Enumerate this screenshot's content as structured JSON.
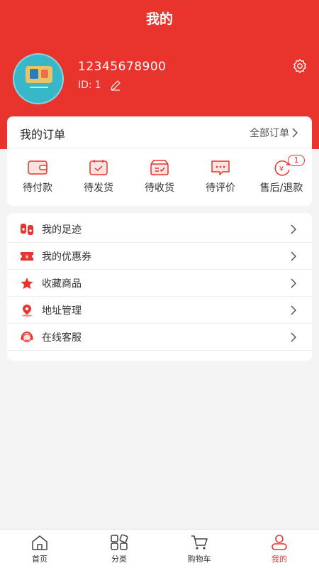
{
  "header": {
    "title": "我的"
  },
  "profile": {
    "phone": "12345678900",
    "id_label": "ID:",
    "id_value": "1"
  },
  "orders": {
    "title": "我的订单",
    "all_label": "全部订单",
    "items": [
      {
        "label": "待付款",
        "icon": "wallet-icon"
      },
      {
        "label": "待发货",
        "icon": "calendar-check-icon"
      },
      {
        "label": "待收货",
        "icon": "box-icon"
      },
      {
        "label": "待评价",
        "icon": "comment-icon"
      },
      {
        "label": "售后/退款",
        "icon": "refund-icon",
        "badge": "1"
      }
    ]
  },
  "menu": {
    "items": [
      {
        "label": "我的足迹",
        "icon": "footprint-icon"
      },
      {
        "label": "我的优惠券",
        "icon": "coupon-icon"
      },
      {
        "label": "收藏商品",
        "icon": "star-icon"
      },
      {
        "label": "地址管理",
        "icon": "location-pin-icon"
      },
      {
        "label": "在线客服",
        "icon": "customer-service-icon"
      }
    ]
  },
  "tabbar": {
    "items": [
      {
        "label": "首页",
        "icon": "home-icon"
      },
      {
        "label": "分类",
        "icon": "category-icon"
      },
      {
        "label": "购物车",
        "icon": "cart-icon"
      },
      {
        "label": "我的",
        "icon": "user-icon",
        "active": true
      }
    ]
  },
  "colors": {
    "primary": "#e8342c",
    "background": "#f4f4f4"
  }
}
